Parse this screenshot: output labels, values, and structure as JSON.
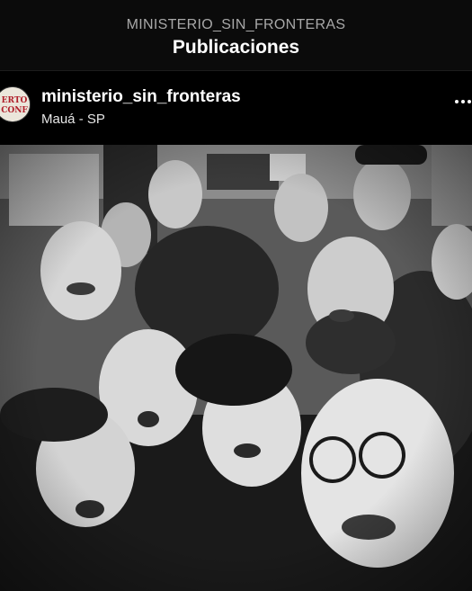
{
  "header": {
    "account_name": "MINISTERIO_SIN_FRONTERAS",
    "title": "Publicaciones"
  },
  "post": {
    "username": "ministerio_sin_fronteras",
    "location": "Mauá - SP",
    "avatar_icon": "profile-logo-icon",
    "more_icon": "more-options-icon",
    "avatar_text_top": "ERTO",
    "avatar_text_bottom": "CONF",
    "photo_style": "black-and-white group selfie"
  }
}
